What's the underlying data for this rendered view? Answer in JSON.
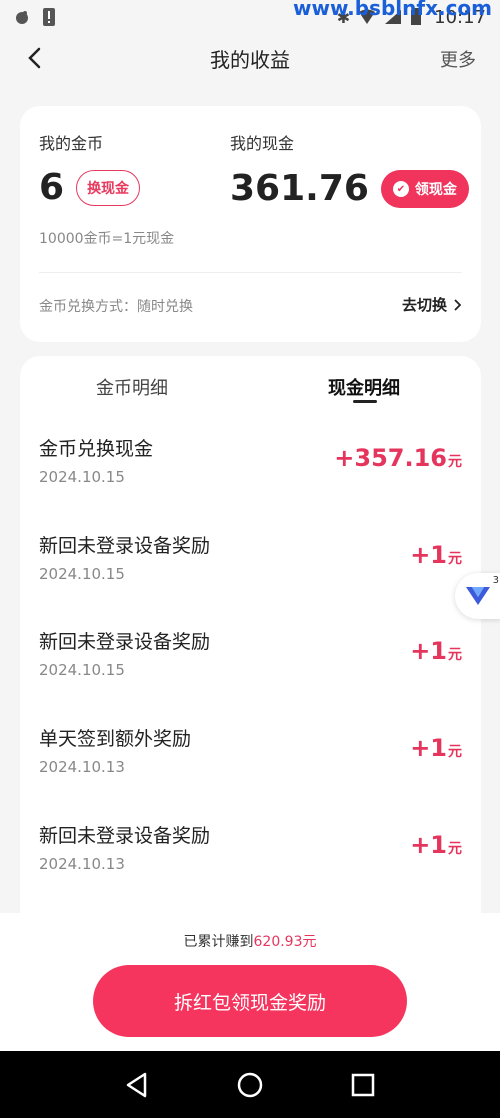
{
  "status_bar": {
    "time": "10:17",
    "watermark": "www.bsblnfx.com"
  },
  "header": {
    "title": "我的收益",
    "more_label": "更多"
  },
  "summary": {
    "coin_label": "我的金币",
    "coin_value": "6",
    "exchange_button": "换现金",
    "cash_label": "我的现金",
    "cash_value": "361.76",
    "withdraw_button": "领现金",
    "rate_text": "10000金币=1元现金",
    "exchange_method": "金币兑换方式：随时兑换",
    "switch_label": "去切换"
  },
  "tabs": [
    {
      "label": "金币明细",
      "active": false
    },
    {
      "label": "现金明细",
      "active": true
    }
  ],
  "transactions": [
    {
      "title": "金币兑换现金",
      "date": "2024.10.15",
      "amount": "+357.16",
      "unit": "元"
    },
    {
      "title": "新回未登录设备奖励",
      "date": "2024.10.15",
      "amount": "+1",
      "unit": "元"
    },
    {
      "title": "新回未登录设备奖励",
      "date": "2024.10.15",
      "amount": "+1",
      "unit": "元"
    },
    {
      "title": "单天签到额外奖励",
      "date": "2024.10.13",
      "amount": "+1",
      "unit": "元"
    },
    {
      "title": "新回未登录设备奖励",
      "date": "2024.10.13",
      "amount": "+1",
      "unit": "元"
    }
  ],
  "floating_badge": {
    "count": "3"
  },
  "bottom": {
    "earned_prefix": "已累计赚到",
    "earned_value": "620.93元",
    "main_button": "拆红包领现金奖励"
  },
  "colors": {
    "accent": "#f0345c",
    "amount": "#e5355d"
  }
}
